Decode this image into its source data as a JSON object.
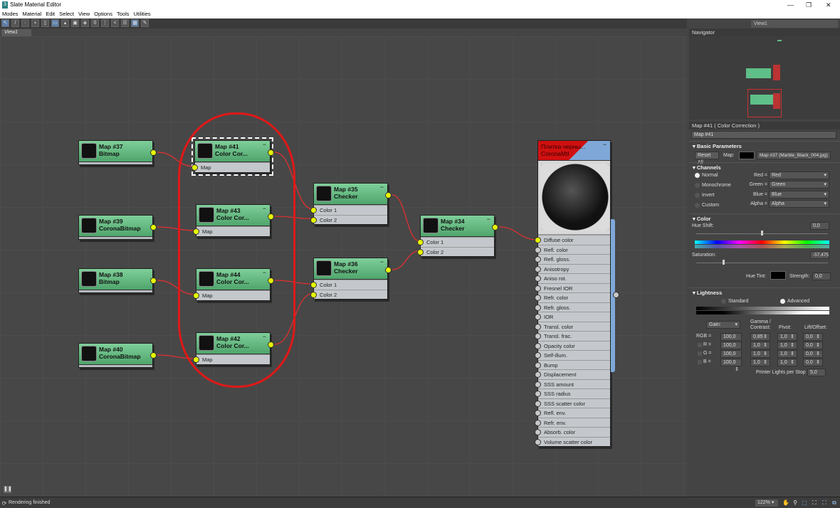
{
  "window": {
    "title": "Slate Material Editor",
    "controls": [
      "—",
      "❐",
      "✕"
    ]
  },
  "menu": [
    "Modes",
    "Material",
    "Edit",
    "Select",
    "View",
    "Options",
    "Tools",
    "Utilities"
  ],
  "toolbar": {
    "view_selector": "View1"
  },
  "view_tab": "View1",
  "nodes": [
    {
      "title": "Map #37",
      "type": "Bitmap",
      "slots": []
    },
    {
      "title": "Map #39",
      "type": "CoronaBitmap",
      "slots": []
    },
    {
      "title": "Map #38",
      "type": "Bitmap",
      "slots": []
    },
    {
      "title": "Map #40",
      "type": "CoronaBitmap",
      "slots": []
    },
    {
      "title": "Map #41",
      "type": "Color Cor...",
      "slots": [
        "Map"
      ]
    },
    {
      "title": "Map #43",
      "type": "Color Cor...",
      "slots": [
        "Map"
      ]
    },
    {
      "title": "Map #44",
      "type": "Color Cor...",
      "slots": [
        "Map"
      ]
    },
    {
      "title": "Map #42",
      "type": "Color Cor...",
      "slots": [
        "Map"
      ]
    },
    {
      "title": "Map #35",
      "type": "Checker",
      "slots": [
        "Color 1",
        "Color 2"
      ]
    },
    {
      "title": "Map #36",
      "type": "Checker",
      "slots": [
        "Color 1",
        "Color 2"
      ]
    },
    {
      "title": "Map #34",
      "type": "Checker",
      "slots": [
        "Color 1",
        "Color 2"
      ]
    }
  ],
  "material": {
    "title": "Плитка черны...",
    "type": "CoronaMtl",
    "slots": [
      "Diffuse color",
      "Refl. color",
      "Refl. gloss.",
      "Anisotropy",
      "Aniso rot.",
      "Fresnel IOR",
      "Refr. color",
      "Refr. gloss.",
      "IOR",
      "Transl. color",
      "Transl. frac.",
      "Opacity color",
      "Self-illum.",
      "Bump",
      "Displacement",
      "SSS amount",
      "SSS radius",
      "SSS scatter color",
      "Refl. env.",
      "Refr. env.",
      "Absorb. color",
      "Volume scatter color"
    ]
  },
  "navigator": {
    "title": "Navigator"
  },
  "params": {
    "header": "Map #41  ( Color Correction )",
    "name": "Map #41",
    "basic": {
      "title": "Basic Parameters",
      "reset": "Reset All",
      "map_label": "Map:",
      "map_value": "Map #37 (Marble_Black_004.jpg)"
    },
    "channels": {
      "title": "Channels",
      "modes": [
        "Normal",
        "Monochrome",
        "Invert",
        "Custom"
      ],
      "selected": "Normal",
      "rows": [
        {
          "label": "Red =",
          "value": "Red"
        },
        {
          "label": "Green =",
          "value": "Green"
        },
        {
          "label": "Blue =",
          "value": "Blue"
        },
        {
          "label": "Alpha =",
          "value": "Alpha"
        }
      ]
    },
    "color": {
      "title": "Color",
      "hue_shift_label": "Hue Shift:",
      "hue_shift": "0,0",
      "saturation_label": "Saturation:",
      "saturation": "-57,475",
      "hue_tint_label": "Hue Tint:",
      "strength_label": "Strength:",
      "strength": "0,0"
    },
    "lightness": {
      "title": "Lightness",
      "standard": "Standard",
      "advanced": "Advanced",
      "selected": "Advanced",
      "gain": "Gain:",
      "gamma": "Gamma / Contrast:",
      "pivot": "Pivot:",
      "lift": "Lift/Offset:",
      "rows": [
        {
          "label": "RGB =",
          "gain": "100,0",
          "gamma": "0,85",
          "pivot": "1,0",
          "lift": "0,0"
        },
        {
          "label": "R =",
          "gain": "100,0",
          "gamma": "1,0",
          "pivot": "1,0",
          "lift": "0,0"
        },
        {
          "label": "G =",
          "gain": "100,0",
          "gamma": "1,0",
          "pivot": "1,0",
          "lift": "0,0"
        },
        {
          "label": "B =",
          "gain": "100,0",
          "gamma": "1,0",
          "pivot": "1,0",
          "lift": "0,0"
        }
      ],
      "printer_label": "Printer Lights per Stop",
      "printer": "5,0"
    }
  },
  "status": {
    "text": "Rendering finished",
    "zoom": "122%"
  }
}
